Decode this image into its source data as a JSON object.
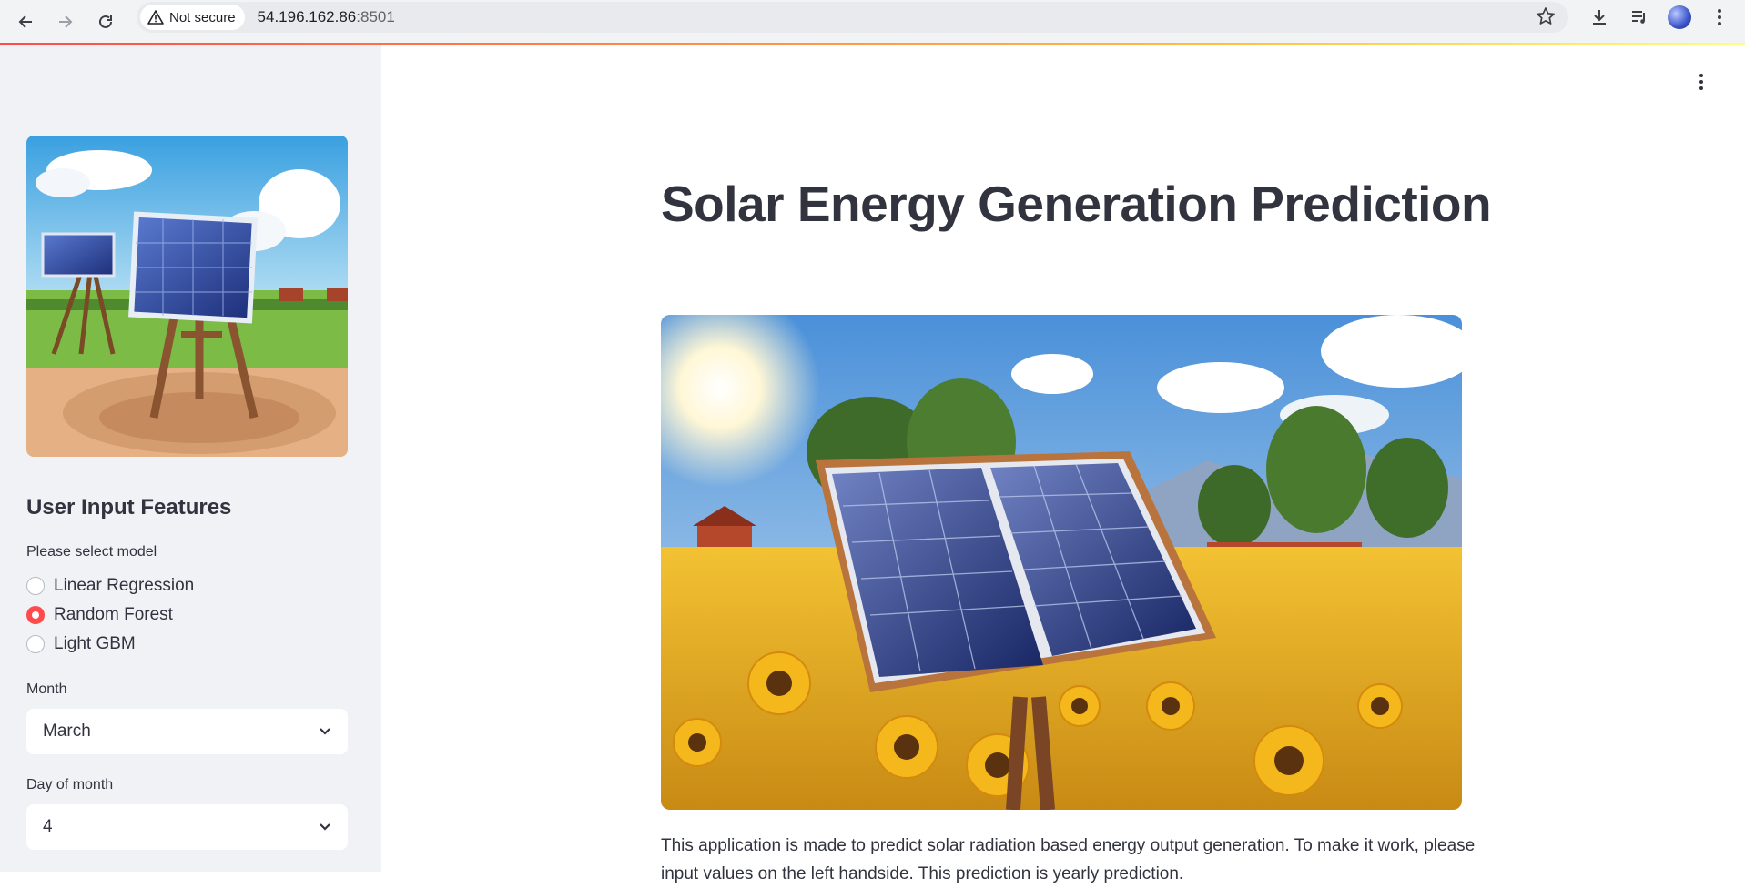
{
  "browser": {
    "security_label": "Not secure",
    "url_host": "54.196.162.86",
    "url_port": ":8501"
  },
  "sidebar": {
    "heading": "User Input Features",
    "model_label": "Please select model",
    "models": [
      {
        "label": "Linear Regression",
        "selected": false
      },
      {
        "label": "Random Forest",
        "selected": true
      },
      {
        "label": "Light GBM",
        "selected": false
      }
    ],
    "month_label": "Month",
    "month_value": "March",
    "day_label": "Day of month",
    "day_value": "4"
  },
  "main": {
    "title": "Solar Energy Generation Prediction",
    "description": "This application is made to predict solar radiation based energy output generation. To make it work, please input values on the left handside. This prediction is yearly prediction."
  },
  "colors": {
    "accent": "#ff4b4b",
    "sidebar_bg": "#f0f2f6",
    "text": "#31333f"
  }
}
